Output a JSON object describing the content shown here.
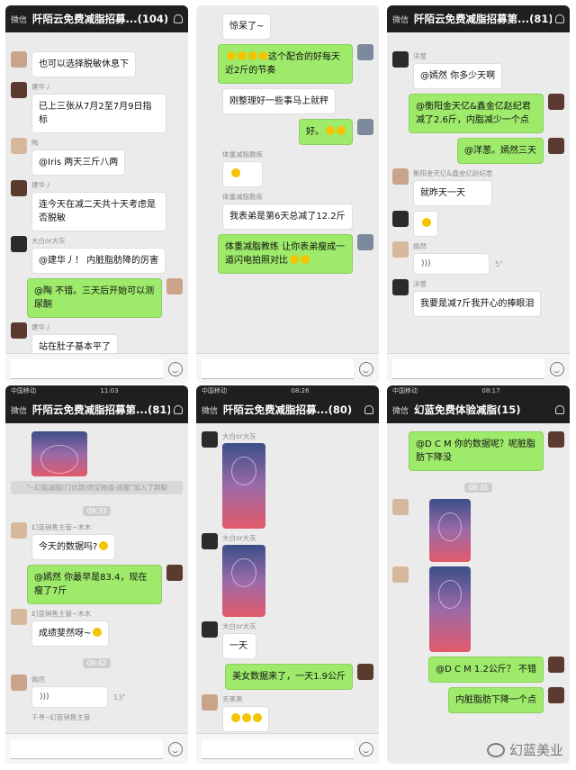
{
  "colors": {
    "titlebar": "#1f1f1f",
    "chat_bg": "#ebebeb",
    "own_bubble": "#9eea6a",
    "other_bubble": "#ffffff"
  },
  "panels": [
    {
      "back": "微信",
      "title": "阡陌云免费减脂招募...(104)",
      "m": [
        "也可以选择脱敏休息下",
        "建华丿",
        "已上三张从7月2至7月9日指标",
        "陶",
        "@Iris 两天三斤八两",
        "建华丿",
        "连今天在减二天共十天考虑是否脱敏",
        "大白or大灰",
        "@建华丿！ 内脏脂肪降的厉害",
        "@陶 不错。三天后开始可以测尿酮",
        "建华丿",
        "站在肚子基本平了"
      ]
    },
    {
      "m": [
        "惊呆了~",
        "这个配合的好每天近2斤的节奏",
        "刚整理好一些事马上就秤",
        "好。",
        "体重减脂教练",
        "体重减脂教练",
        "我表弟是第6天总减了12.2斤",
        "体重减脂教练 让你表弟瘦成一道闪电拍照对比"
      ]
    },
    {
      "back": "微信",
      "title": "阡陌云免费减脂招募第...(81)",
      "m": [
        "洋葱",
        "@嫣然 你多少天啊",
        "@衡阳金天亿&鑫金亿赵纪君 减了2.6斤，内脂减少一个点",
        "@洋葱。嫣然三天",
        "衡阳金天亿&鑫金亿赵纪君",
        "就昨天一天",
        "嫣然",
        "5\"",
        "洋葱",
        "我要是减7斤我开心的捧眼泪"
      ]
    },
    {
      "status_l": "中国移动",
      "status_c": "11:03",
      "back": "微信",
      "title": "阡陌云免费减脂招募第...(81)",
      "m": [
        "“--幻蓝减脂(门诊部)师宝物语-成都”加入了群聊",
        "09:33",
        "幻蓝销售主管~木木",
        "今天的数据吗?",
        "@嫣然 你最早是83.4，现在瘦了7斤",
        "幻蓝销售主管~木木",
        "成绩斐然呀~",
        "09:42",
        "嫣然",
        "13\"",
        "千寻--幻蓝销售主管"
      ]
    },
    {
      "status_l": "中国移动",
      "status_c": "08:26",
      "back": "微信",
      "title": "阡陌云免费减脂招募...(80)",
      "m": [
        "大白or大灰",
        "大白or大灰",
        "大白or大灰",
        "一天",
        "美女数据来了，一天1.9公斤",
        "天黑黑"
      ]
    },
    {
      "status_l": "中国移动",
      "status_c": "08:17",
      "back": "微信",
      "title": "幻蓝免费体验减脂(15)",
      "m": [
        "@D C M 你的数据呢？呢脏脂肪下降没",
        "08:35",
        "@D C M 1.2公斤？ 不错",
        "内脏脂肪下降一个点"
      ]
    }
  ],
  "watermark": "幻蓝美业"
}
